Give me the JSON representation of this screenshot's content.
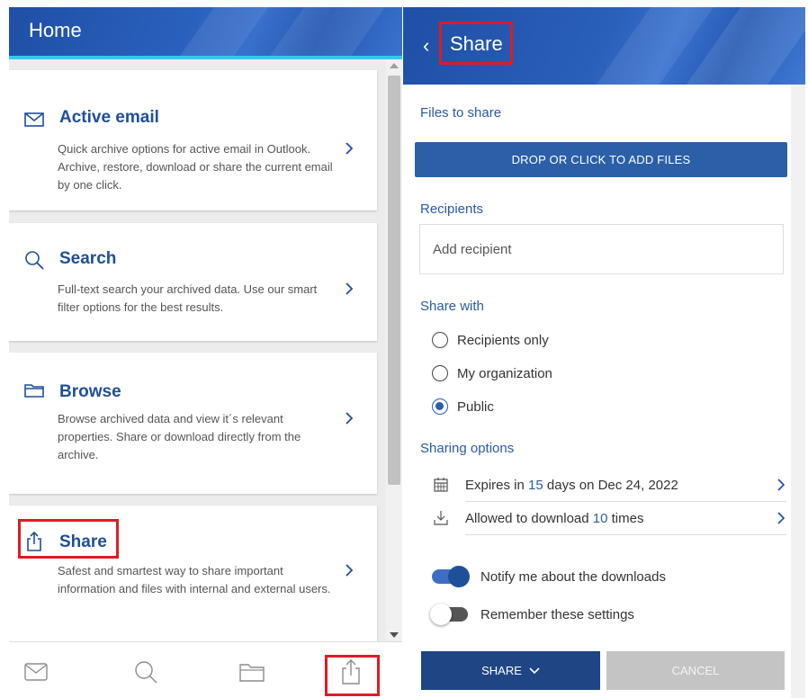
{
  "home": {
    "title": "Home",
    "cards": [
      {
        "icon": "mail-icon",
        "title": "Active email",
        "description": "Quick archive options for active email in Outlook. Archive, restore, download or share the current email by one click."
      },
      {
        "icon": "search-icon",
        "title": "Search",
        "description": "Full-text search your archived data. Use our smart filter options for the best results."
      },
      {
        "icon": "folder-icon",
        "title": "Browse",
        "description": "Browse archived data and view it´s relevant properties. Share or download directly from the archive."
      },
      {
        "icon": "share-icon",
        "title": "Share",
        "description": "Safest and smartest way to share important information and files with internal and external users."
      }
    ],
    "bottom_nav": [
      "mail-icon",
      "search-icon",
      "folder-icon",
      "share-icon"
    ]
  },
  "share_panel": {
    "back_icon": "chevron-left-icon",
    "title": "Share",
    "files_label": "Files to share",
    "drop_button": "DROP OR CLICK TO ADD FILES",
    "recipients_label": "Recipients",
    "recipient_placeholder": "Add recipient",
    "share_with_label": "Share with",
    "share_with_options": [
      {
        "label": "Recipients only",
        "selected": false
      },
      {
        "label": "My organization",
        "selected": false
      },
      {
        "label": "Public",
        "selected": true
      }
    ],
    "sharing_options_label": "Sharing options",
    "expires": {
      "prefix": "Expires in ",
      "days": "15",
      "suffix": " days on Dec 24, 2022"
    },
    "download": {
      "prefix": "Allowed to download ",
      "count": "10",
      "suffix": " times"
    },
    "notify_label": "Notify me about the downloads",
    "notify_on": true,
    "remember_label": "Remember these settings",
    "remember_on": false,
    "share_button": "SHARE",
    "cancel_button": "CANCEL"
  },
  "colors": {
    "brand": "#1f4f99",
    "accent_line": "#37c6f2",
    "highlight": "#e01b24"
  }
}
